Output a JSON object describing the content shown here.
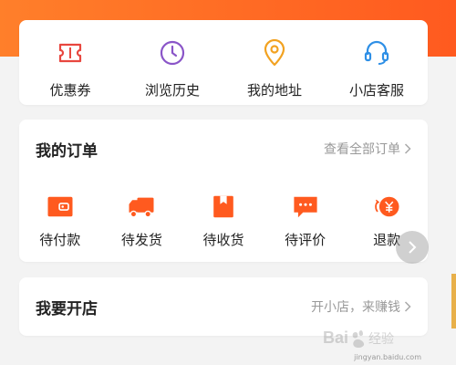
{
  "quick_actions": [
    {
      "label": "优惠券",
      "icon": "coupon-icon"
    },
    {
      "label": "浏览历史",
      "icon": "clock-icon"
    },
    {
      "label": "我的地址",
      "icon": "location-pin-icon"
    },
    {
      "label": "小店客服",
      "icon": "headset-icon"
    }
  ],
  "orders": {
    "title": "我的订单",
    "view_all": "查看全部订单",
    "items": [
      {
        "label": "待付款",
        "icon": "wallet-icon"
      },
      {
        "label": "待发货",
        "icon": "truck-icon"
      },
      {
        "label": "待收货",
        "icon": "package-icon"
      },
      {
        "label": "待评价",
        "icon": "comment-icon"
      },
      {
        "label": "退款",
        "icon": "refund-icon"
      }
    ]
  },
  "shop": {
    "title": "我要开店",
    "cta": "开小店，来赚钱"
  },
  "watermark": {
    "caption": "jingyan.baidu.com"
  },
  "colors": {
    "accent": "#ff5a1f",
    "coupon": "#e8473f",
    "history": "#8a55c8",
    "address": "#f2a221",
    "service": "#2e8fe6"
  }
}
